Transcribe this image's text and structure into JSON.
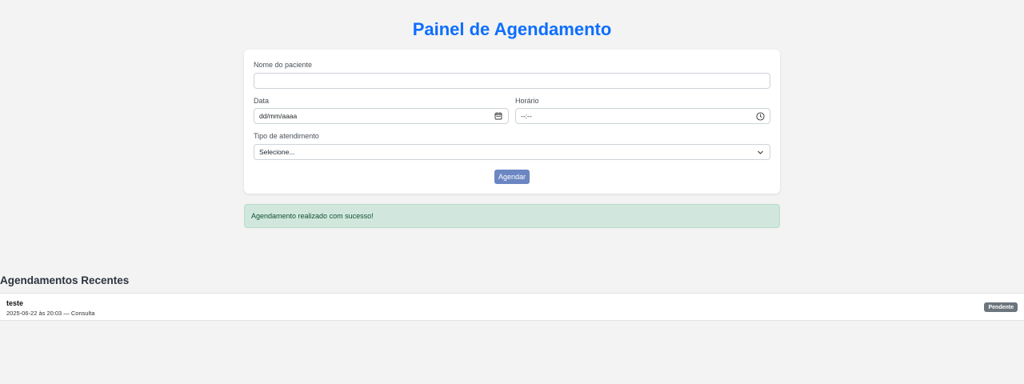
{
  "title": "Painel de Agendamento",
  "form": {
    "patient_label": "Nome do paciente",
    "patient_value": "",
    "date_label": "Data",
    "date_placeholder": "dd/mm/aaaa",
    "time_label": "Horário",
    "time_placeholder": "--:--",
    "type_label": "Tipo de atendimento",
    "type_selected": "Selecione...",
    "submit_label": "Agendar"
  },
  "alert": {
    "message": "Agendamento realizado com sucesso!",
    "color": "#d1e7dd"
  },
  "recent": {
    "title": "Agendamentos Recentes",
    "items": [
      {
        "name": "teste",
        "meta": "2025-06-22 às 20:03 — Consulta",
        "status": "Pendente"
      }
    ]
  },
  "colors": {
    "accent": "#0d6efd",
    "button": "#6b86c2",
    "badge": "#6c757d"
  },
  "icons": {
    "date": "calendar-icon",
    "time": "clock-icon",
    "select": "chevron-down-icon"
  }
}
